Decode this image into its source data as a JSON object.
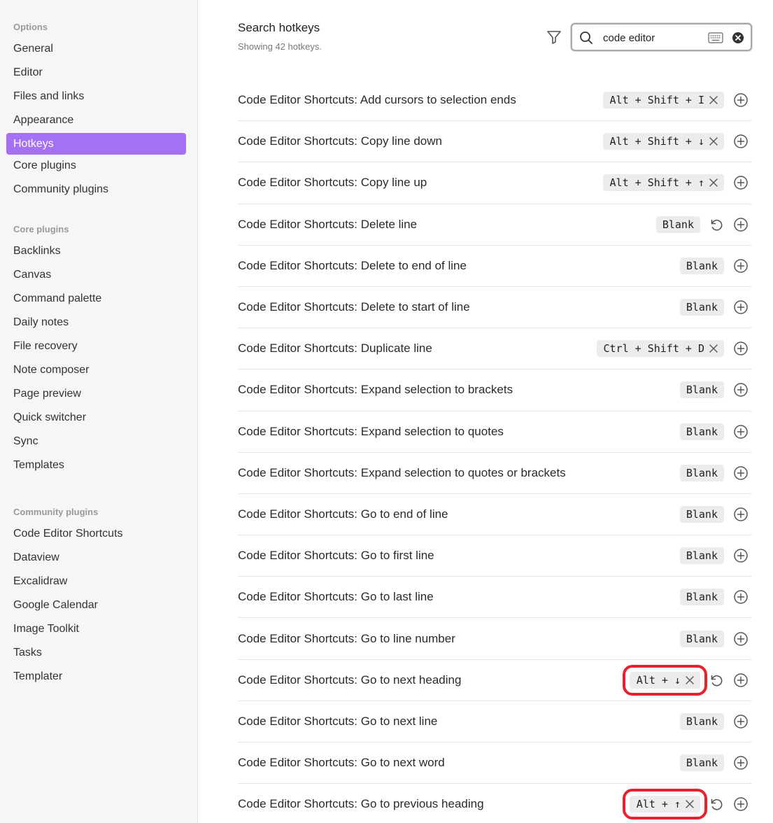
{
  "sidebar": {
    "groups": [
      {
        "heading": "Options",
        "items": [
          "General",
          "Editor",
          "Files and links",
          "Appearance",
          "Hotkeys",
          "Core plugins",
          "Community plugins"
        ]
      },
      {
        "heading": "Core plugins",
        "items": [
          "Backlinks",
          "Canvas",
          "Command palette",
          "Daily notes",
          "File recovery",
          "Note composer",
          "Page preview",
          "Quick switcher",
          "Sync",
          "Templates"
        ]
      },
      {
        "heading": "Community plugins",
        "items": [
          "Code Editor Shortcuts",
          "Dataview",
          "Excalidraw",
          "Google Calendar",
          "Image Toolkit",
          "Tasks",
          "Templater"
        ]
      }
    ],
    "active_item": "Hotkeys"
  },
  "header": {
    "title": "Search hotkeys",
    "subtitle": "Showing 42 hotkeys."
  },
  "search": {
    "value": "code editor",
    "placeholder": "",
    "icons": [
      "filter-icon",
      "search-icon",
      "keyboard-icon",
      "clear-icon"
    ]
  },
  "hotkeys": [
    {
      "label": "Code Editor Shortcuts: Add cursors to selection ends",
      "hotkey": "Alt + Shift + I",
      "blank": false,
      "reset": false,
      "highlighted": false
    },
    {
      "label": "Code Editor Shortcuts: Copy line down",
      "hotkey": "Alt + Shift + ↓",
      "blank": false,
      "reset": false,
      "highlighted": false
    },
    {
      "label": "Code Editor Shortcuts: Copy line up",
      "hotkey": "Alt + Shift + ↑",
      "blank": false,
      "reset": false,
      "highlighted": false
    },
    {
      "label": "Code Editor Shortcuts: Delete line",
      "hotkey": "Blank",
      "blank": true,
      "reset": true,
      "highlighted": false
    },
    {
      "label": "Code Editor Shortcuts: Delete to end of line",
      "hotkey": "Blank",
      "blank": true,
      "reset": false,
      "highlighted": false
    },
    {
      "label": "Code Editor Shortcuts: Delete to start of line",
      "hotkey": "Blank",
      "blank": true,
      "reset": false,
      "highlighted": false
    },
    {
      "label": "Code Editor Shortcuts: Duplicate line",
      "hotkey": "Ctrl + Shift + D",
      "blank": false,
      "reset": false,
      "highlighted": false
    },
    {
      "label": "Code Editor Shortcuts: Expand selection to brackets",
      "hotkey": "Blank",
      "blank": true,
      "reset": false,
      "highlighted": false
    },
    {
      "label": "Code Editor Shortcuts: Expand selection to quotes",
      "hotkey": "Blank",
      "blank": true,
      "reset": false,
      "highlighted": false
    },
    {
      "label": "Code Editor Shortcuts: Expand selection to quotes or brackets",
      "hotkey": "Blank",
      "blank": true,
      "reset": false,
      "highlighted": false
    },
    {
      "label": "Code Editor Shortcuts: Go to end of line",
      "hotkey": "Blank",
      "blank": true,
      "reset": false,
      "highlighted": false
    },
    {
      "label": "Code Editor Shortcuts: Go to first line",
      "hotkey": "Blank",
      "blank": true,
      "reset": false,
      "highlighted": false
    },
    {
      "label": "Code Editor Shortcuts: Go to last line",
      "hotkey": "Blank",
      "blank": true,
      "reset": false,
      "highlighted": false
    },
    {
      "label": "Code Editor Shortcuts: Go to line number",
      "hotkey": "Blank",
      "blank": true,
      "reset": false,
      "highlighted": false
    },
    {
      "label": "Code Editor Shortcuts: Go to next heading",
      "hotkey": "Alt + ↓",
      "blank": false,
      "reset": true,
      "highlighted": true
    },
    {
      "label": "Code Editor Shortcuts: Go to next line",
      "hotkey": "Blank",
      "blank": true,
      "reset": false,
      "highlighted": false
    },
    {
      "label": "Code Editor Shortcuts: Go to next word",
      "hotkey": "Blank",
      "blank": true,
      "reset": false,
      "highlighted": false
    },
    {
      "label": "Code Editor Shortcuts: Go to previous heading",
      "hotkey": "Alt + ↑",
      "blank": false,
      "reset": true,
      "highlighted": true
    }
  ],
  "colors": {
    "accent": "#a571f4",
    "highlight": "#e8212e",
    "chip_bg": "#ececec"
  }
}
